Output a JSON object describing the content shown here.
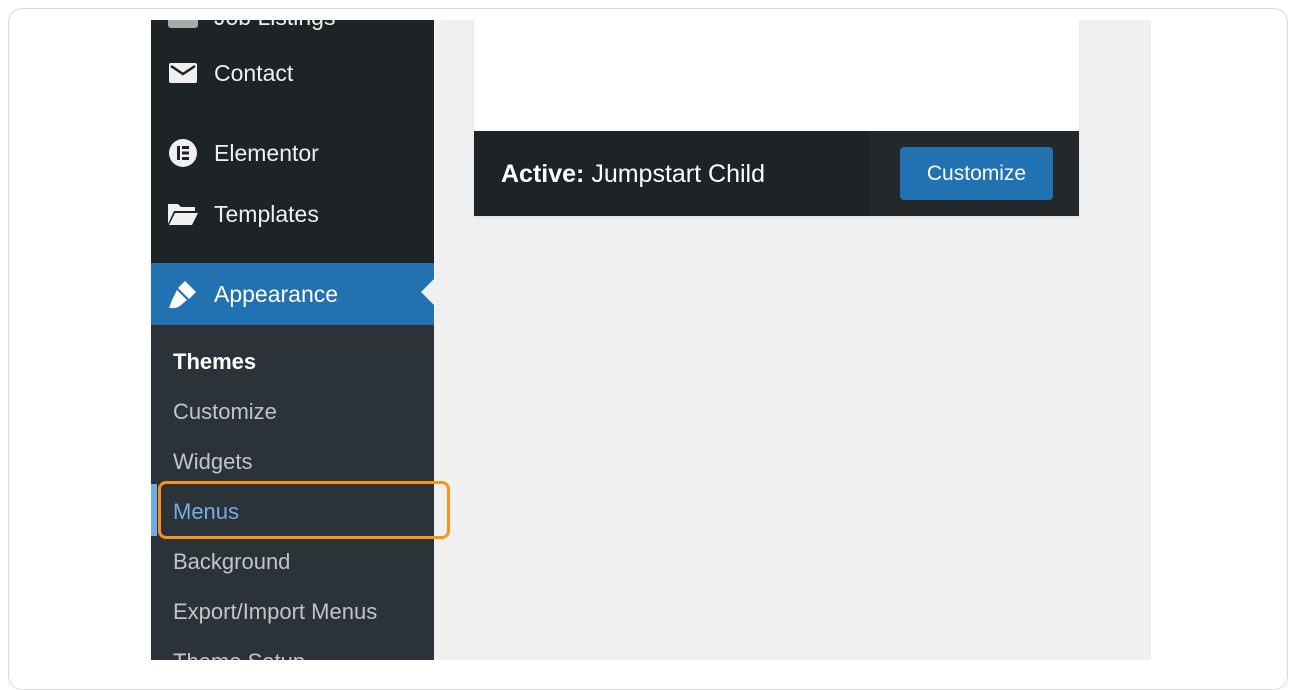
{
  "sidebar": {
    "items": [
      {
        "label": "Job Listings",
        "icon": "listings-icon"
      },
      {
        "label": "Contact",
        "icon": "envelope-icon"
      },
      {
        "label": "Elementor",
        "icon": "elementor-icon"
      },
      {
        "label": "Templates",
        "icon": "folder-icon"
      },
      {
        "label": "Appearance",
        "icon": "paintbrush-icon"
      }
    ],
    "submenu": [
      {
        "label": "Themes"
      },
      {
        "label": "Customize"
      },
      {
        "label": "Widgets"
      },
      {
        "label": "Menus"
      },
      {
        "label": "Background"
      },
      {
        "label": "Export/Import Menus"
      },
      {
        "label": "Theme Setup"
      }
    ]
  },
  "theme": {
    "active_prefix": "Active:",
    "active_name": "Jumpstart Child",
    "customize_label": "Customize"
  },
  "colors": {
    "sidebar_bg": "#1d2327",
    "accent": "#2271b1",
    "hover_link": "#72aee6",
    "highlight": "#f7941d"
  }
}
